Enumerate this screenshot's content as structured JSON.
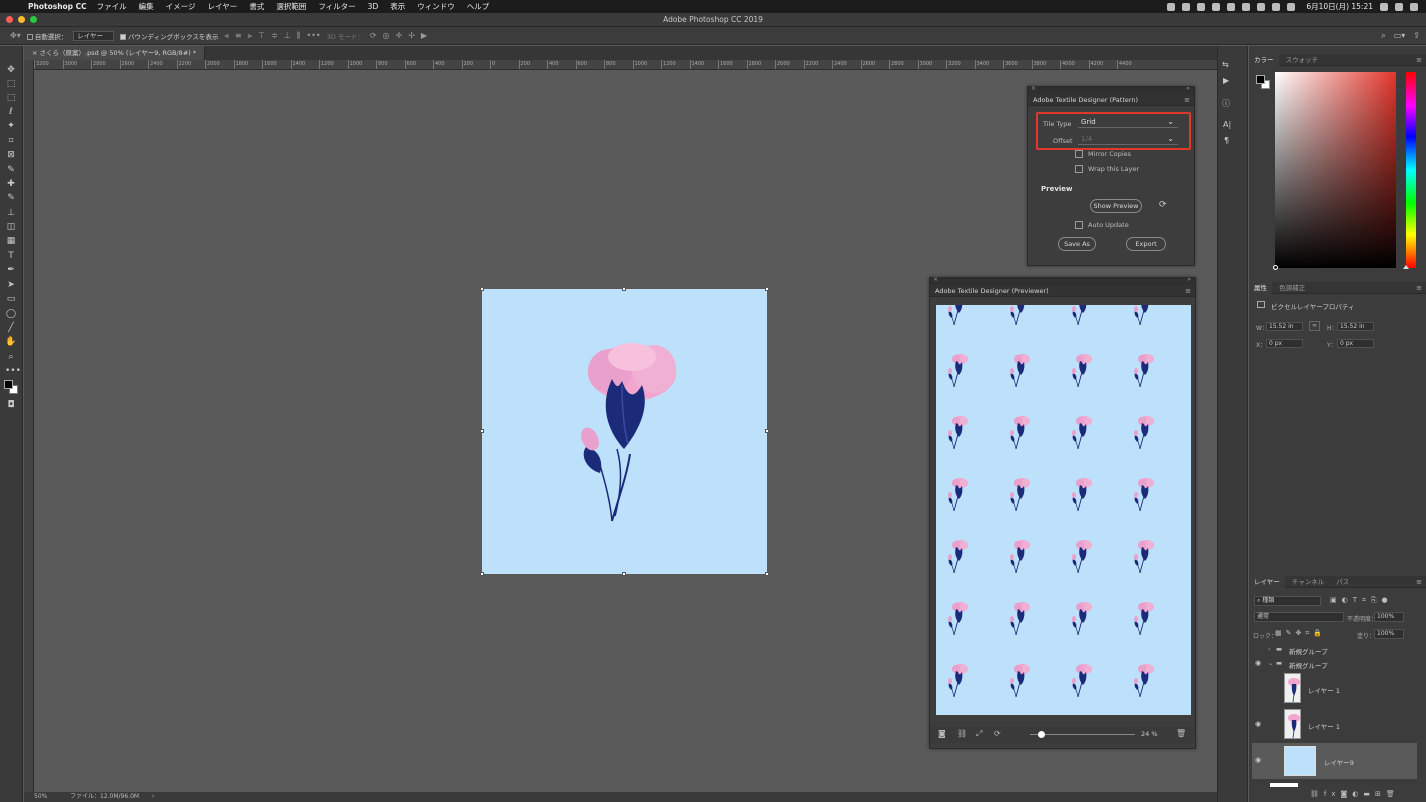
{
  "menubar": {
    "app_name": "Photoshop CC",
    "items": [
      "ファイル",
      "編集",
      "イメージ",
      "レイヤー",
      "書式",
      "選択範囲",
      "フィルター",
      "3D",
      "表示",
      "ウィンドウ",
      "ヘルプ"
    ],
    "clock": "6月10日(月)  15:21"
  },
  "window": {
    "title": "Adobe Photoshop CC 2019"
  },
  "options_bar": {
    "auto_select_label": "自動選択：",
    "auto_select_value": "レイヤー",
    "bounding_box_label": "バウンディングボックスを表示",
    "mode_label": "3D モード："
  },
  "document": {
    "tab_label": "さくら（原案）.psd @ 50% (レイヤー9, RGB/8#) *",
    "zoom": "50%",
    "file_info": "ファイル：12.0M/96.0M"
  },
  "ruler_ticks": [
    "3200",
    "3000",
    "2800",
    "2600",
    "2400",
    "2200",
    "2000",
    "1800",
    "1600",
    "1400",
    "1200",
    "1000",
    "800",
    "600",
    "400",
    "200",
    "0",
    "200",
    "400",
    "600",
    "800",
    "1000",
    "1200",
    "1400",
    "1600",
    "1800",
    "2000",
    "2200",
    "2400",
    "2600",
    "2800",
    "3000",
    "3200",
    "3400",
    "3600",
    "3800",
    "4000",
    "4200",
    "4400"
  ],
  "pattern_panel": {
    "title": "Adobe Textile Designer (Pattern)",
    "tile_type_label": "Tile Type",
    "tile_type_value": "Grid",
    "offset_label": "Offset",
    "offset_value": "1/4",
    "mirror_label": "Mirror Copies",
    "wrap_label": "Wrap this Layer",
    "preview_heading": "Preview",
    "show_preview_label": "Show Preview",
    "auto_update_label": "Auto Update",
    "save_as_label": "Save As",
    "export_label": "Export"
  },
  "previewer_panel": {
    "title": "Adobe Textile Designer (Previewer)",
    "zoom": "24 %",
    "zoom_fraction": 0.1
  },
  "color_panel": {
    "tabs": [
      "カラー",
      "スウォッチ"
    ],
    "fg_color": "#000000",
    "bg_color": "#ffffff"
  },
  "properties_panel": {
    "tabs": [
      "属性",
      "色調補正"
    ],
    "heading": "ピクセルレイヤープロパティ",
    "w_label": "W：",
    "w_value": "15.52 in",
    "h_label": "H：",
    "h_value": "15.52 in",
    "x_label": "X：",
    "x_value": "0 px",
    "y_label": "Y：",
    "y_value": "0 px"
  },
  "layers_panel": {
    "tabs": [
      "レイヤー",
      "チャンネル",
      "パス"
    ],
    "filter_label": "種類",
    "blend_mode": "通常",
    "opacity_label": "不透明度：",
    "opacity_value": "100%",
    "lock_label": "ロック：",
    "fill_label": "塗り：",
    "fill_value": "100%",
    "layers": [
      {
        "name": "新規グループ",
        "type": "group",
        "visible": false
      },
      {
        "name": "新規グループ",
        "type": "group",
        "visible": true
      },
      {
        "name": "レイヤー 1",
        "type": "pixel",
        "visible": false
      },
      {
        "name": "レイヤー 1",
        "type": "pixel",
        "visible": true
      },
      {
        "name": "レイヤー9",
        "type": "pixel",
        "visible": true
      }
    ]
  },
  "colors": {
    "canvas_bg": "#bde0fb",
    "petal": "#f2a6cf",
    "stem": "#1c2a7a",
    "highlight_red": "#e0382b"
  }
}
